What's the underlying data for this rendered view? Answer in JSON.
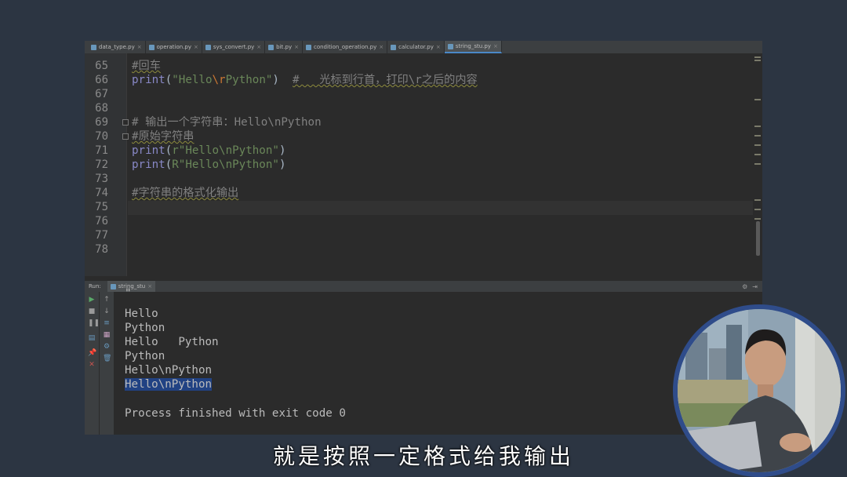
{
  "tabs": [
    {
      "label": "data_type.py"
    },
    {
      "label": "operation.py"
    },
    {
      "label": "sys_convert.py"
    },
    {
      "label": "bit.py"
    },
    {
      "label": "condition_operation.py"
    },
    {
      "label": "calculator.py"
    },
    {
      "label": "string_stu.py",
      "active": true
    }
  ],
  "editor": {
    "line_numbers": [
      "65",
      "66",
      "67",
      "68",
      "69",
      "70",
      "71",
      "72",
      "73",
      "74",
      "75",
      "76",
      "77",
      "78"
    ],
    "lines": {
      "l65": "#回车",
      "l66_print": "print",
      "l66_open": "(",
      "l66_str1": "\"Hello",
      "l66_esc": "\\r",
      "l66_str2": "Python\"",
      "l66_close": ")",
      "l66_comment": "#   光标到行首，打印\\r之后的内容",
      "l69": "# 输出一个字符串：Hello\\nPython",
      "l70": "#原始字符串",
      "l71_print": "print",
      "l71_open": "(",
      "l71_str": "r\"Hello\\nPython\"",
      "l71_close": ")",
      "l72_print": "print",
      "l72_open": "(",
      "l72_str": "R\"Hello\\nPython\"",
      "l72_close": ")",
      "l74": "#字符串的格式化输出"
    }
  },
  "run": {
    "label": "Run:",
    "tab": "string_stu",
    "output": [
      "\"",
      "Hello",
      "Python",
      "Hello   Python",
      "Python",
      "Hello\\nPython",
      "Hello\\nPython",
      "",
      "Process finished with exit code 0"
    ]
  },
  "subtitle": "就是按照一定格式给我输出",
  "colors": {
    "keyword": "#a9b7c6",
    "builtin": "#8888c6",
    "string": "#6a8759",
    "escape": "#cc7832",
    "comment": "#808080",
    "selection": "#214283"
  },
  "icons": [
    "python-file-icon",
    "run-icon",
    "stop-icon",
    "pause-icon",
    "settings-icon",
    "close-icon"
  ]
}
